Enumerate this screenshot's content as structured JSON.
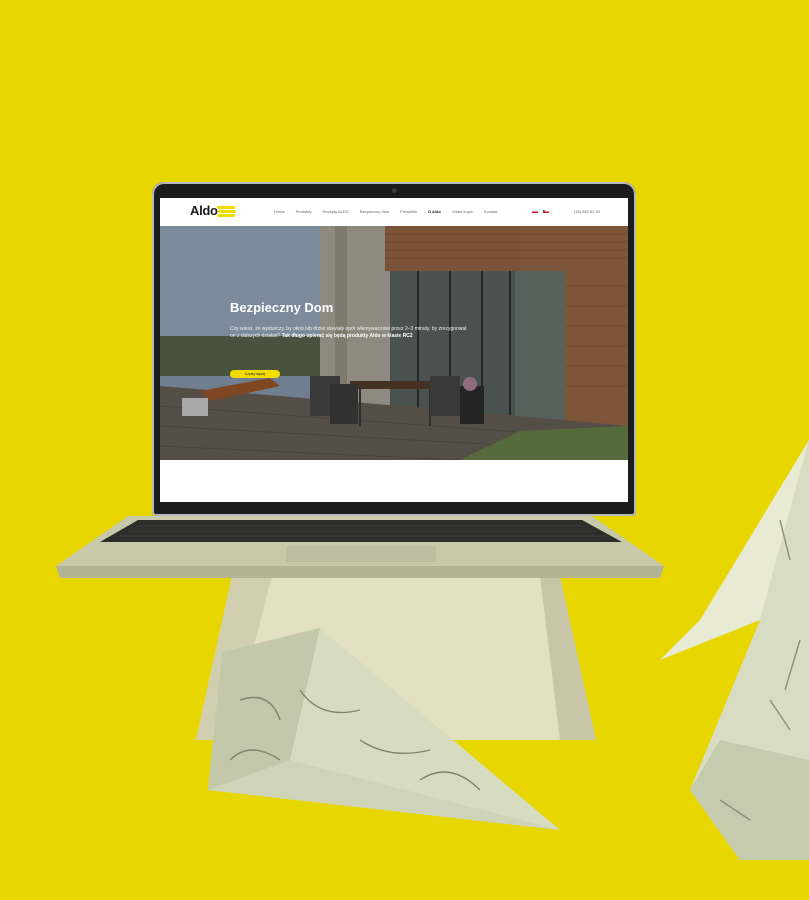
{
  "site": {
    "brand": "Aldo",
    "nav": [
      "Home",
      "Produkty",
      "Recepty ALDO",
      "Bezpieczny dom",
      "Poradniki",
      "O Aldo",
      "Gdzie kupić",
      "Kontakt"
    ],
    "active_nav_index": 5,
    "languages": [
      "pl",
      "cz"
    ],
    "phone": "(33) 852 82 52"
  },
  "hero": {
    "title": "Bezpieczny Dom",
    "text_regular": "Czy wiesz, że wystarczy, by okno lub drzwi stawiały opór włamywaczowi przez 2–3 minuty, by zrezygnował on z dalszych działań?",
    "text_bold": "Tak długo opierać się będą produkty Aldo w klasie RC2",
    "button_label": "Czytaj więcej"
  },
  "colors": {
    "background": "#e8d600",
    "accent": "#f2dc00"
  }
}
